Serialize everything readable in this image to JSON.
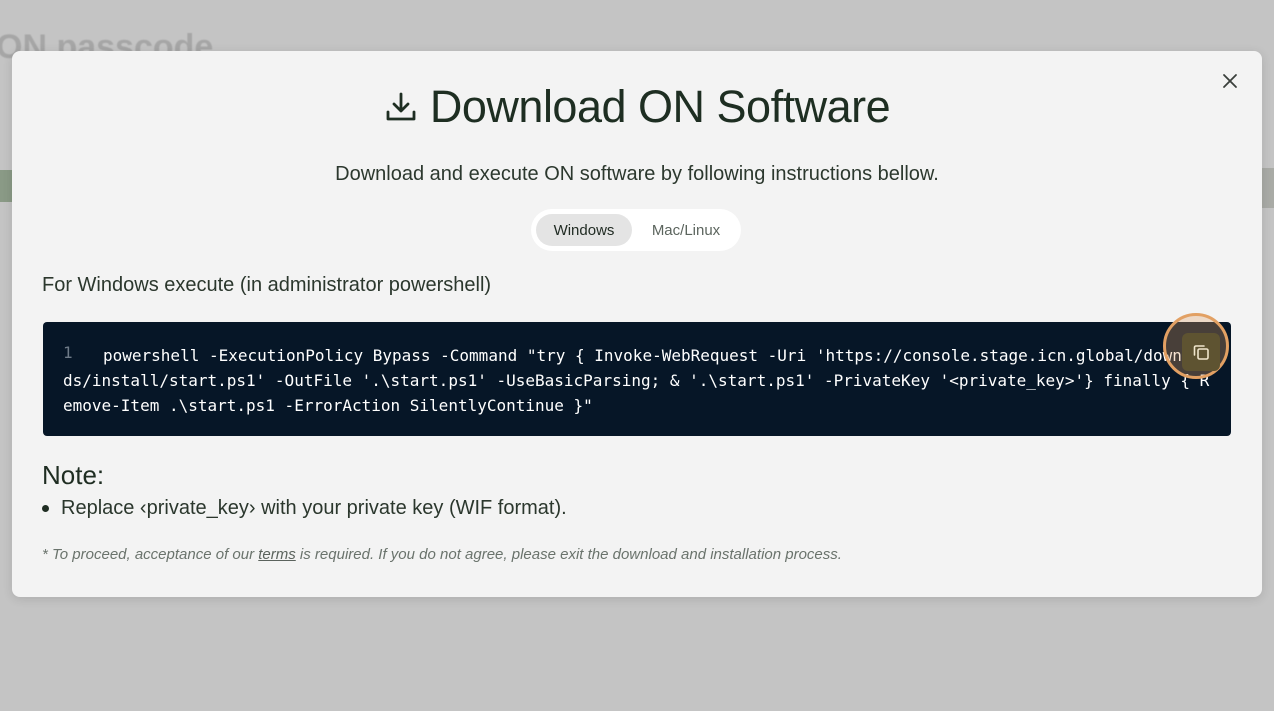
{
  "backdrop": {
    "title": "ON passcode"
  },
  "modal": {
    "title": "Download ON Software",
    "subtitle": "Download and execute ON software by following instructions bellow.",
    "tabs": [
      {
        "label": "Windows",
        "active": true
      },
      {
        "label": "Mac/Linux",
        "active": false
      }
    ],
    "section_label": "For Windows execute (in administrator powershell)",
    "code": {
      "line_number": "1",
      "text": "powershell -ExecutionPolicy Bypass -Command \"try { Invoke-WebRequest -Uri 'https://console.stage.icn.global/downloads/install/start.ps1' -OutFile '.\\start.ps1' -UseBasicParsing; & '.\\start.ps1' -PrivateKey '<private_key>'} finally { Remove-Item .\\start.ps1 -ErrorAction SilentlyContinue }\""
    },
    "note": {
      "title": "Note:",
      "items": [
        "Replace ‹private_key› with your private key (WIF format)."
      ]
    },
    "terms": {
      "prefix": "* To proceed, acceptance of our ",
      "link_label": "terms",
      "suffix": " is required. If you do not agree, please exit the download and installation process."
    }
  },
  "icons": {
    "download": "download-icon",
    "close": "close-icon",
    "copy": "copy-icon"
  },
  "colors": {
    "code_bg": "#061627",
    "copy_button": "#5e5331",
    "copy_highlight": "#e2a063",
    "modal_bg": "#f3f3f3",
    "title_text": "#1e2e22"
  }
}
